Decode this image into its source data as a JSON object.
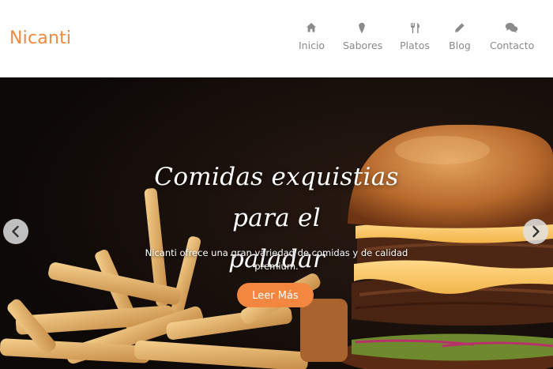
{
  "brand": {
    "name": "Nicanti",
    "color": "#f0883e"
  },
  "nav": {
    "items": [
      {
        "label": "Inicio",
        "icon": "home-icon"
      },
      {
        "label": "Sabores",
        "icon": "ice-cream-icon"
      },
      {
        "label": "Platos",
        "icon": "utensils-icon"
      },
      {
        "label": "Blog",
        "icon": "pencil-icon"
      },
      {
        "label": "Contacto",
        "icon": "chat-bubbles-icon"
      }
    ]
  },
  "hero": {
    "title_line1": "Comidas exquistias para el",
    "title_line2": "paladar",
    "description": "Nicanti ofrece una gran variedad de comidas y de calidad premium.",
    "cta_label": "Leer Más",
    "cta_color": "#f3873f",
    "prev_icon": "chevron-left-icon",
    "next_icon": "chevron-right-icon"
  }
}
